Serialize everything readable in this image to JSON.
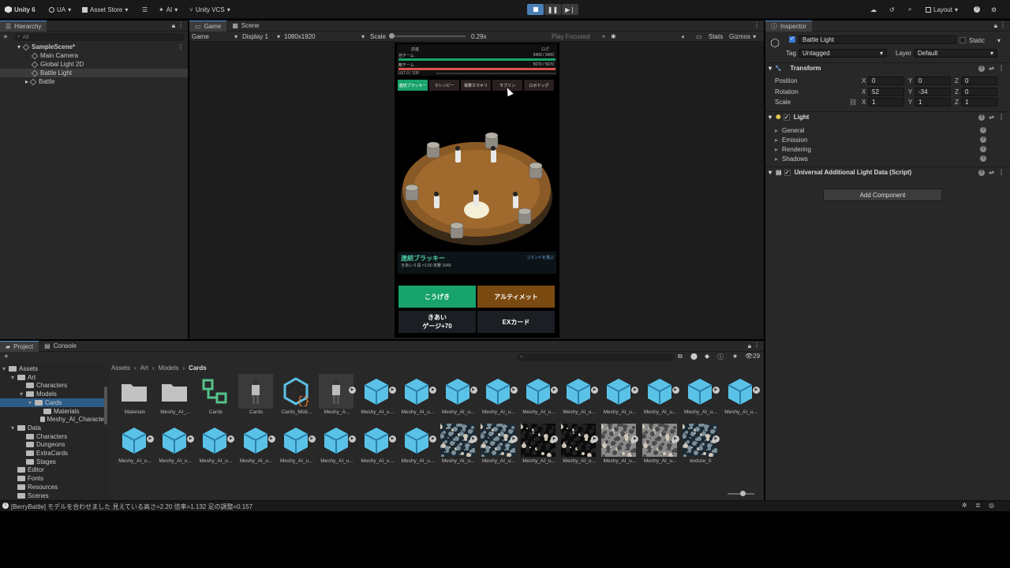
{
  "topbar": {
    "account": "Unity 6",
    "ua": "UA",
    "asset_store": "Asset Store",
    "ai": "AI",
    "vcs": "Unity VCS",
    "layout": "Layout"
  },
  "hierarchy": {
    "tab": "Hierarchy",
    "search_placeholder": "All",
    "scene": "SampleScene*",
    "items": [
      "Main Camera",
      "Global Light 2D",
      "Battle Light",
      "Battle"
    ]
  },
  "game": {
    "tabs": [
      "Game",
      "Scene"
    ],
    "mode": "Game",
    "display": "Display 1",
    "resolution": "1080x1920",
    "scale_label": "Scale",
    "scale_value": "0.29x",
    "play_focused": "Play Focused",
    "stats": "Stats",
    "gizmos": "Gizmos"
  },
  "phone": {
    "top_left": "前進",
    "top_right": "ログ",
    "team1_label": "自チーム",
    "team1_hp": "3400 / 3400",
    "team2_label": "敵チーム",
    "team2_hp": "5670 / 5670",
    "ult": "ULT  0 / 100",
    "tabs": [
      "連続ブラッキー",
      "マシンピー",
      "電撃カマキリ",
      "モブリン",
      "ロボドッグ"
    ],
    "char_name": "連続ブラッキー",
    "char_stats": "きあい 0 段  ×1.00  攻撃 1540",
    "select_cmd": "コマンドを選ぶ",
    "btn_attack": "こうげき",
    "btn_ultimate": "アルティメット",
    "btn_kiai_1": "きあい",
    "btn_kiai_2": "ゲージ+70",
    "btn_ex": "EXカード"
  },
  "inspector": {
    "tab": "Inspector",
    "object_name": "Battle Light",
    "static_label": "Static",
    "tag_label": "Tag",
    "tag_value": "Untagged",
    "layer_label": "Layer",
    "layer_value": "Default",
    "transform": "Transform",
    "position_label": "Position",
    "rotation_label": "Rotation",
    "scale_label": "Scale",
    "pos": [
      "0",
      "0",
      "0"
    ],
    "rot": [
      "52",
      "-34",
      "0"
    ],
    "scl": [
      "1",
      "1",
      "1"
    ],
    "light": "Light",
    "light_sections": [
      "General",
      "Emission",
      "Rendering",
      "Shadows"
    ],
    "script": "Universal Additional Light Data (Script)",
    "add_component": "Add Component"
  },
  "project": {
    "tabs": [
      "Project",
      "Console"
    ],
    "count": "29",
    "breadcrumb": [
      "Assets",
      "Art",
      "Models",
      "Cards"
    ],
    "tree": [
      {
        "label": "Assets",
        "indent": 0,
        "arrow": "▾"
      },
      {
        "label": "Art",
        "indent": 1,
        "arrow": "▾"
      },
      {
        "label": "Characters",
        "indent": 2,
        "arrow": ""
      },
      {
        "label": "Models",
        "indent": 2,
        "arrow": "▾"
      },
      {
        "label": "Cards",
        "indent": 3,
        "arrow": "▾",
        "selected": true
      },
      {
        "label": "Materials",
        "indent": 4,
        "arrow": ""
      },
      {
        "label": "Meshy_AI_Characte",
        "indent": 4,
        "arrow": ""
      },
      {
        "label": "Data",
        "indent": 1,
        "arrow": "▾"
      },
      {
        "label": "Characters",
        "indent": 2,
        "arrow": ""
      },
      {
        "label": "Dungeons",
        "indent": 2,
        "arrow": ""
      },
      {
        "label": "ExtraCards",
        "indent": 2,
        "arrow": ""
      },
      {
        "label": "Stages",
        "indent": 2,
        "arrow": ""
      },
      {
        "label": "Editor",
        "indent": 1,
        "arrow": ""
      },
      {
        "label": "Fonts",
        "indent": 1,
        "arrow": ""
      },
      {
        "label": "Resources",
        "indent": 1,
        "arrow": ""
      },
      {
        "label": "Scenes",
        "indent": 1,
        "arrow": ""
      }
    ],
    "assets_row1": [
      {
        "label": "Materials",
        "kind": "folder"
      },
      {
        "label": "Meshy_AI_...",
        "kind": "folder"
      },
      {
        "label": "Cards",
        "kind": "prefab-var"
      },
      {
        "label": "Cards",
        "kind": "character"
      },
      {
        "label": "Cards_Moti...",
        "kind": "script"
      },
      {
        "label": "Meshy_A...",
        "kind": "character-play"
      },
      {
        "label": "Meshy_AI_u...",
        "kind": "mesh"
      },
      {
        "label": "Meshy_AI_u...",
        "kind": "mesh"
      },
      {
        "label": "Meshy_AI_u...",
        "kind": "mesh"
      },
      {
        "label": "Meshy_AI_u...",
        "kind": "mesh"
      },
      {
        "label": "Meshy_AI_u...",
        "kind": "mesh"
      },
      {
        "label": "Meshy_AI_u...",
        "kind": "mesh"
      },
      {
        "label": "Meshy_AI_u...",
        "kind": "mesh"
      },
      {
        "label": "Meshy_AI_u...",
        "kind": "mesh"
      },
      {
        "label": "Meshy_AI_u...",
        "kind": "mesh"
      },
      {
        "label": "Meshy_AI_u...",
        "kind": "mesh"
      }
    ],
    "assets_row2": [
      {
        "label": "Meshy_AI_u...",
        "kind": "mesh"
      },
      {
        "label": "Meshy_AI_u...",
        "kind": "mesh"
      },
      {
        "label": "Meshy_AI_u...",
        "kind": "mesh"
      },
      {
        "label": "Meshy_AI_u...",
        "kind": "mesh"
      },
      {
        "label": "Meshy_AI_u...",
        "kind": "mesh"
      },
      {
        "label": "Meshy_AI_u...",
        "kind": "mesh"
      },
      {
        "label": "Meshy_AI_u...",
        "kind": "mesh"
      },
      {
        "label": "Meshy_AI_u...",
        "kind": "mesh"
      },
      {
        "label": "Meshy_AI_u...",
        "kind": "tex-color"
      },
      {
        "label": "Meshy_AI_u...",
        "kind": "tex-color"
      },
      {
        "label": "Meshy_AI_u...",
        "kind": "tex-dark"
      },
      {
        "label": "Meshy_AI_u...",
        "kind": "tex-dark"
      },
      {
        "label": "Meshy_AI_u...",
        "kind": "tex-gray"
      },
      {
        "label": "Meshy_AI_u...",
        "kind": "tex-gray"
      },
      {
        "label": "texture_0",
        "kind": "tex-color"
      }
    ]
  },
  "status": {
    "message": "[BerryBattle] モデルを合わせました  見えている高さ=2.20  倍率=1.132  足の調整=0.157"
  },
  "colors": {
    "accent_green": "#17a36b",
    "accent_brown": "#7a4a10",
    "selection_blue": "#2c5d87",
    "mesh_cyan": "#5bc2e7"
  }
}
